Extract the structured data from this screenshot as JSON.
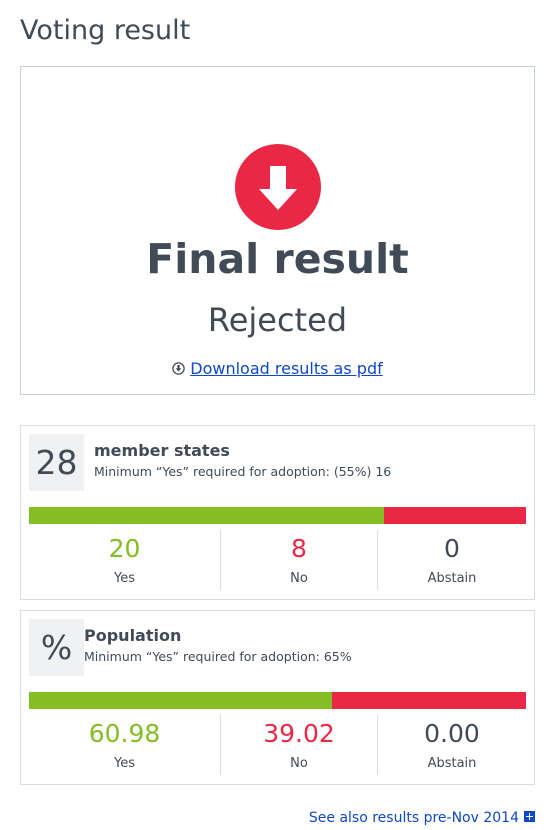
{
  "page": {
    "title": "Voting result"
  },
  "final": {
    "icon": "arrow-down-circle-icon",
    "title": "Final result",
    "value": "Rejected",
    "download_label": "Download results as pdf",
    "download_icon": "download-circle-icon"
  },
  "member_states": {
    "badge": "28",
    "heading": "member states",
    "subtitle": "Minimum “Yes” required for adoption: (55%) 16",
    "counts": {
      "yes": {
        "value": "20",
        "label": "Yes"
      },
      "no": {
        "value": "8",
        "label": "No"
      },
      "abstain": {
        "value": "0",
        "label": "Abstain"
      }
    },
    "share": {
      "yes": 20,
      "no": 8,
      "abstain": 0
    }
  },
  "population": {
    "badge": "%",
    "heading": "Population",
    "subtitle": "Minimum “Yes” required for adoption: 65%",
    "counts": {
      "yes": {
        "value": "60.98",
        "label": "Yes"
      },
      "no": {
        "value": "39.02",
        "label": "No"
      },
      "abstain": {
        "value": "0.00",
        "label": "Abstain"
      }
    },
    "share": {
      "yes": 60.98,
      "no": 39.02,
      "abstain": 0
    }
  },
  "footer": {
    "see_also_label": "See also results pre-Nov 2014",
    "see_also_icon": "plus-square-icon"
  },
  "colors": {
    "yes": "#84bd24",
    "no": "#ea2845",
    "link": "#0e47cb",
    "text": "#404b57"
  }
}
